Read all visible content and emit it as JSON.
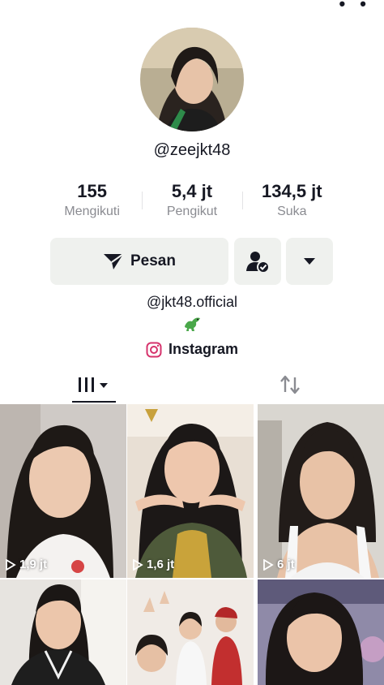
{
  "profile": {
    "username": "@zeejkt48",
    "link": "@jkt48.official",
    "instagram_label": "Instagram"
  },
  "stats": [
    {
      "value": "155",
      "label": "Mengikuti"
    },
    {
      "value": "5,4 jt",
      "label": "Pengikut"
    },
    {
      "value": "134,5 jt",
      "label": "Suka"
    }
  ],
  "actions": {
    "message_label": "Pesan"
  },
  "icons": {
    "message": "send-icon",
    "follow": "person-check-icon",
    "more": "caret-down-icon",
    "instagram": "instagram-icon",
    "videos_tab": "grid-icon",
    "repost_tab": "repost-icon",
    "play": "play-icon",
    "emoji": "dinosaur-emoji"
  },
  "videos": [
    {
      "views": "1,9 jt"
    },
    {
      "views": "1,6 jt"
    },
    {
      "views": "6 jt"
    },
    {
      "views": ""
    },
    {
      "views": ""
    },
    {
      "views": ""
    }
  ],
  "colors": {
    "button_bg": "#eff1ee",
    "text_primary": "#161823",
    "text_secondary": "#8a8b91"
  }
}
